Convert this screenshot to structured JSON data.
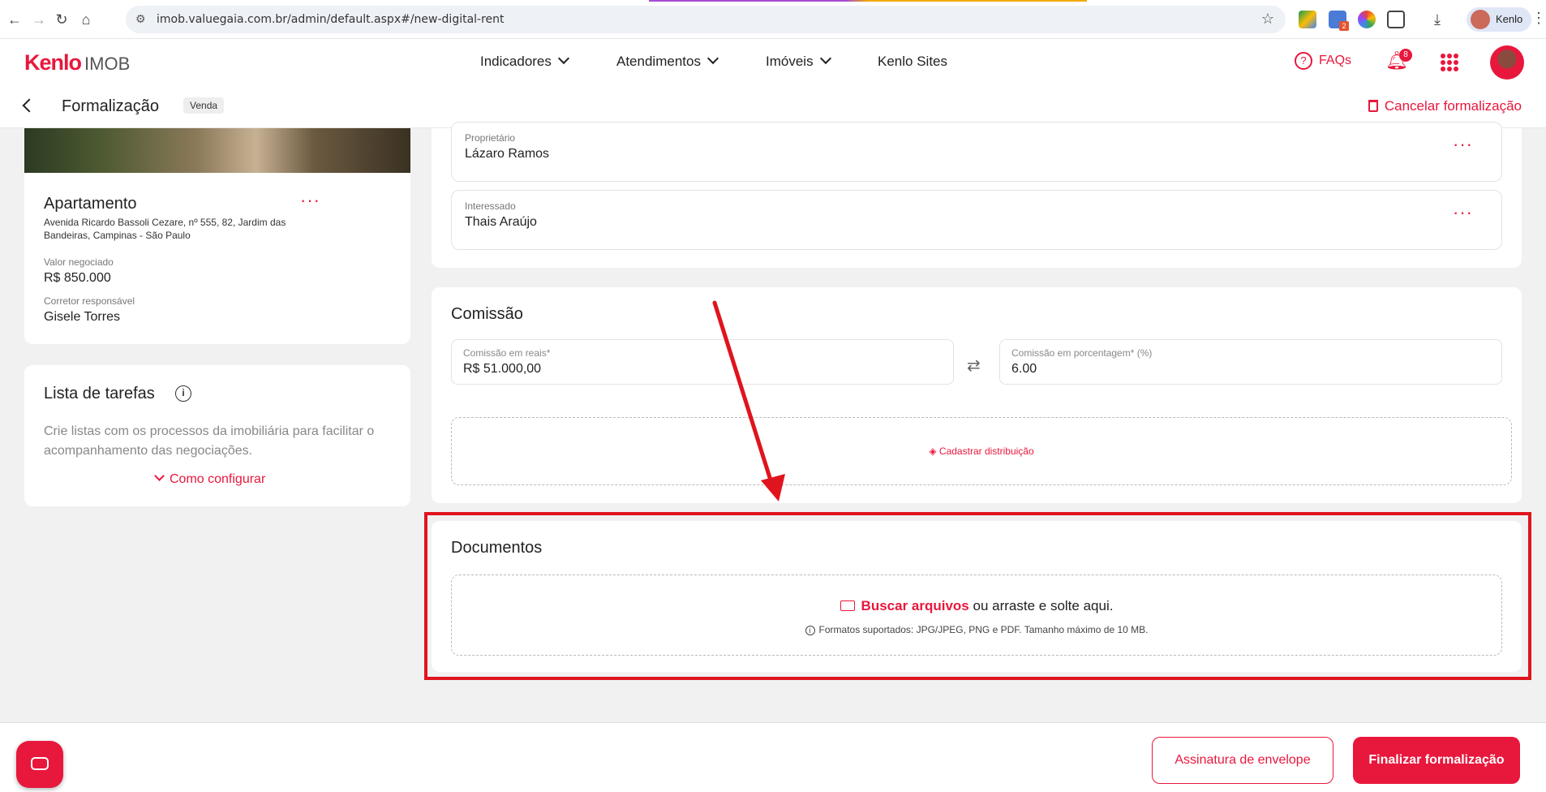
{
  "browser": {
    "url": "imob.valuegaia.com.br/admin/default.aspx#/new-digital-rent",
    "profile_name": "Kenlo",
    "ext_badge": "2"
  },
  "header": {
    "logo_brand": "Kenlo",
    "logo_product": "IMOB",
    "nav": [
      {
        "label": "Indicadores"
      },
      {
        "label": "Atendimentos"
      },
      {
        "label": "Imóveis"
      },
      {
        "label": "Kenlo Sites"
      }
    ],
    "faq_label": "FAQs",
    "notification_count": "8"
  },
  "subheader": {
    "title": "Formalização",
    "badge": "Venda",
    "cancel_label": "Cancelar formalização"
  },
  "property": {
    "type": "Apartamento",
    "address": "Avenida Ricardo Bassoli Cezare, nº 555, 82, Jardim das Bandeiras, Campinas - São Paulo",
    "value_label": "Valor negociado",
    "value": "R$ 850.000",
    "broker_label": "Corretor responsável",
    "broker": "Gisele Torres",
    "more": "···"
  },
  "tasks": {
    "title": "Lista de tarefas",
    "info": "i",
    "description": "Crie listas com os processos da imobiliária para facilitar o acompanhamento das negociações.",
    "link": "Como configurar"
  },
  "parties": [
    {
      "label": "Proprietário",
      "name": "Lázaro Ramos"
    },
    {
      "label": "Interessado",
      "name": "Thais Araújo"
    }
  ],
  "commission": {
    "title": "Comissão",
    "reais_label": "Comissão em reais*",
    "reais_value": "R$ 51.000,00",
    "percent_label": "Comissão em porcentagem* (%)",
    "percent_value": "6.00",
    "distribution_link": "Cadastrar distribuição"
  },
  "documents": {
    "title": "Documentos",
    "browse": "Buscar arquivos",
    "drop_text": " ou arraste e solte aqui.",
    "hint": "Formatos suportados: JPG/JPEG, PNG e PDF. Tamanho máximo de 10 MB."
  },
  "footer": {
    "envelope_button": "Assinatura de envelope",
    "finalize_button": "Finalizar formalização"
  },
  "colors": {
    "brand": "#e8173c",
    "annotation": "#e0141e"
  }
}
